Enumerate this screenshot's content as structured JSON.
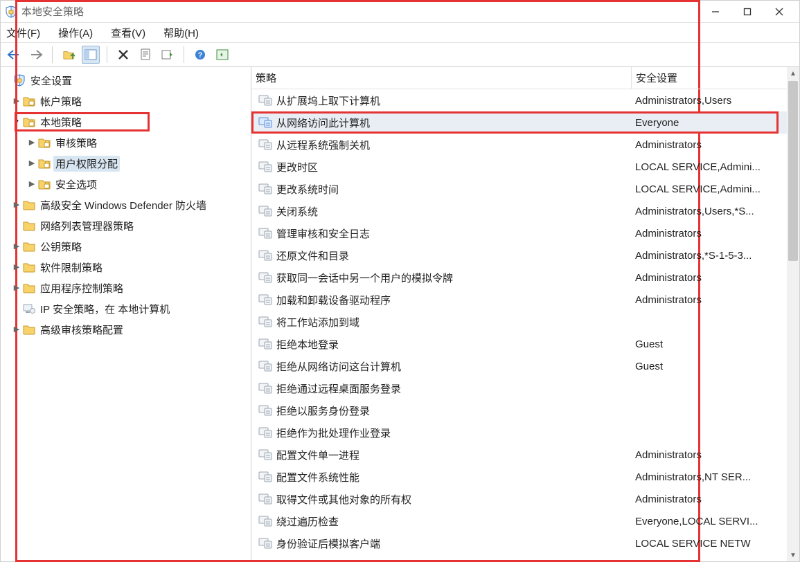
{
  "window": {
    "title": "本地安全策略"
  },
  "menu": {
    "file": "文件(F)",
    "action": "操作(A)",
    "view": "查看(V)",
    "help": "帮助(H)"
  },
  "tree": {
    "root": "安全设置",
    "account_policy": "帐户策略",
    "local_policy": "本地策略",
    "audit_policy": "审核策略",
    "user_rights": "用户权限分配",
    "security_options": "安全选项",
    "defender_fw": "高级安全 Windows Defender 防火墙",
    "net_list_mgr": "网络列表管理器策略",
    "pk_policy": "公钥策略",
    "sw_restrict": "软件限制策略",
    "app_control": "应用程序控制策略",
    "ip_sec": "IP 安全策略，在 本地计算机",
    "adv_audit": "高级审核策略配置"
  },
  "list": {
    "header_policy": "策略",
    "header_setting": "安全设置",
    "rows": [
      {
        "policy": "从扩展坞上取下计算机",
        "setting": "Administrators,Users"
      },
      {
        "policy": "从网络访问此计算机",
        "setting": "Everyone",
        "selected": true,
        "highlighted": true
      },
      {
        "policy": "从远程系统强制关机",
        "setting": "Administrators"
      },
      {
        "policy": "更改时区",
        "setting": "LOCAL SERVICE,Admini..."
      },
      {
        "policy": "更改系统时间",
        "setting": "LOCAL SERVICE,Admini..."
      },
      {
        "policy": "关闭系统",
        "setting": "Administrators,Users,*S..."
      },
      {
        "policy": "管理审核和安全日志",
        "setting": "Administrators"
      },
      {
        "policy": "还原文件和目录",
        "setting": "Administrators,*S-1-5-3..."
      },
      {
        "policy": "获取同一会话中另一个用户的模拟令牌",
        "setting": "Administrators"
      },
      {
        "policy": "加载和卸载设备驱动程序",
        "setting": "Administrators"
      },
      {
        "policy": "将工作站添加到域",
        "setting": ""
      },
      {
        "policy": "拒绝本地登录",
        "setting": "Guest"
      },
      {
        "policy": "拒绝从网络访问这台计算机",
        "setting": "Guest"
      },
      {
        "policy": "拒绝通过远程桌面服务登录",
        "setting": ""
      },
      {
        "policy": "拒绝以服务身份登录",
        "setting": ""
      },
      {
        "policy": "拒绝作为批处理作业登录",
        "setting": ""
      },
      {
        "policy": "配置文件单一进程",
        "setting": "Administrators"
      },
      {
        "policy": "配置文件系统性能",
        "setting": "Administrators,NT SER..."
      },
      {
        "policy": "取得文件或其他对象的所有权",
        "setting": "Administrators"
      },
      {
        "policy": "绕过遍历检查",
        "setting": "Everyone,LOCAL SERVI..."
      },
      {
        "policy": "身份验证后模拟客户端",
        "setting": "LOCAL SERVICE NETW"
      }
    ]
  }
}
